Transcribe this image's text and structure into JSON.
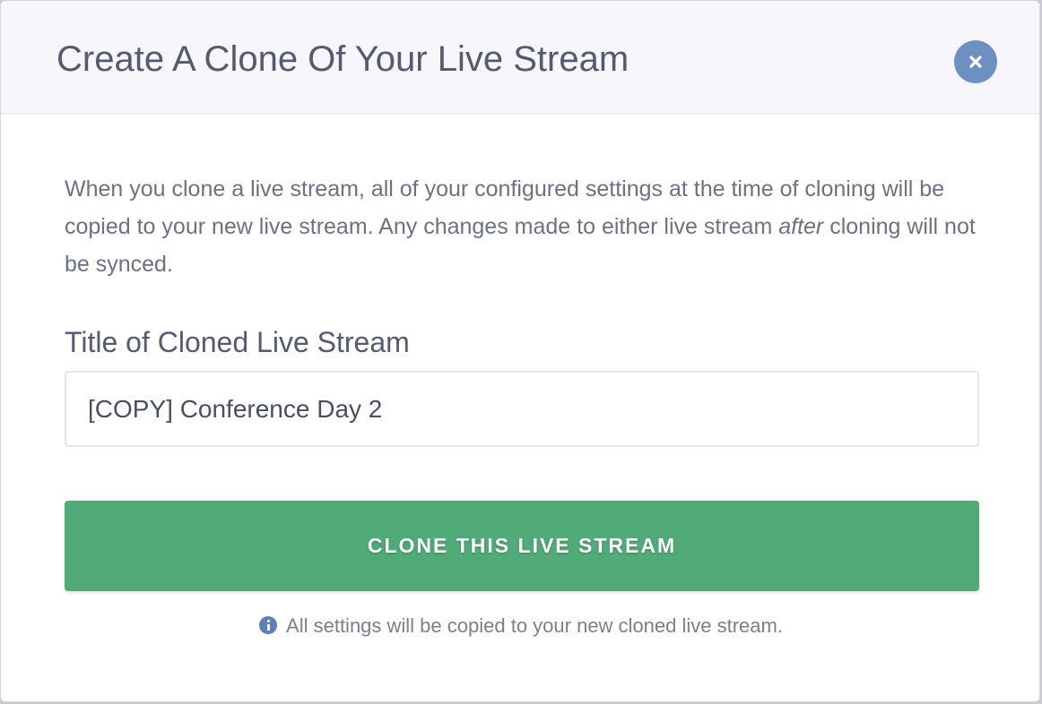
{
  "modal": {
    "title": "Create A Clone Of Your Live Stream",
    "close_icon": "close-icon",
    "description_main": "When you clone a live stream, all of your configured settings at the time of cloning will be copied to your new live stream. Any changes made to either live stream ",
    "description_emphasis": "after",
    "description_tail": " cloning will not be synced.",
    "field_label": "Title of Cloned Live Stream",
    "title_input_value": "[COPY] Conference Day 2",
    "clone_button_label": "CLONE THIS LIVE STREAM",
    "info_icon": "info-icon",
    "info_note": "All settings will be copied to your new cloned live stream."
  },
  "colors": {
    "header_bg": "#f6f6fb",
    "close_button": "#6d8fc1",
    "primary_button": "#50ab78",
    "info_icon": "#5c7fb8",
    "title_text": "#545a70",
    "body_text": "#6c7183"
  }
}
